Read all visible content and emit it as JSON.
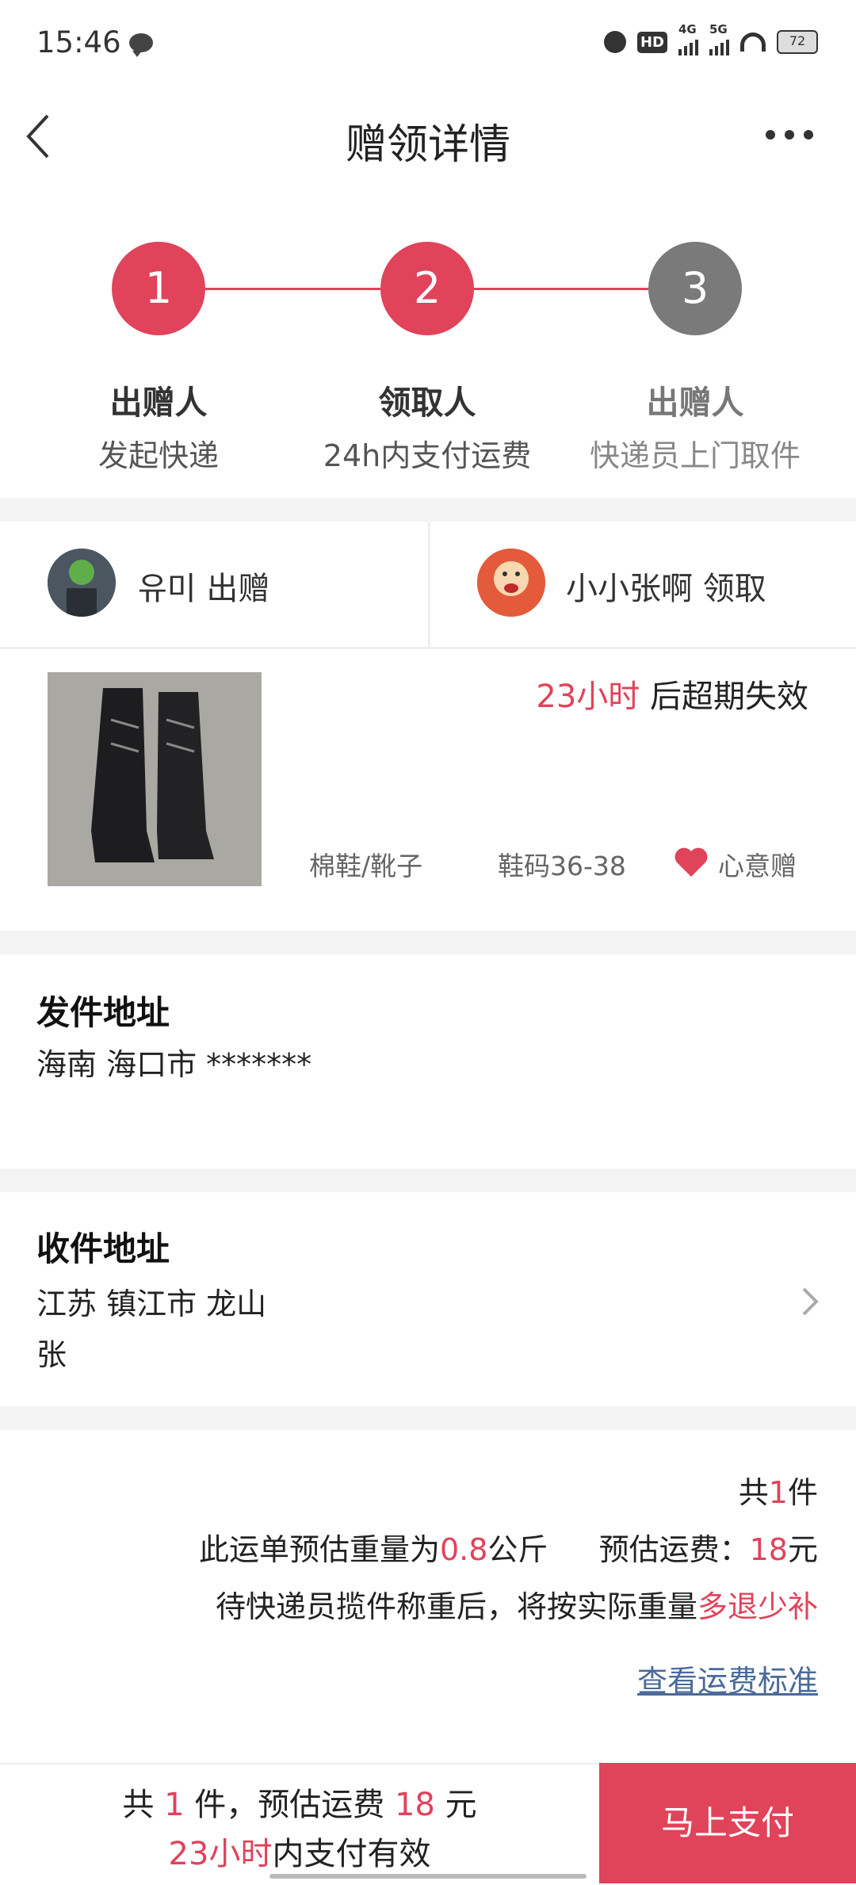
{
  "status_bar": {
    "time": "15:46",
    "battery": "72",
    "net1": "4G",
    "net2": "5G"
  },
  "header": {
    "title": "赠领详情"
  },
  "steps": [
    {
      "num": "1",
      "title": "出赠人",
      "subtitle": "发起快递",
      "color": "#e0435a"
    },
    {
      "num": "2",
      "title": "领取人",
      "subtitle": "24h内支付运费",
      "color": "#e0435a"
    },
    {
      "num": "3",
      "title": "出赠人",
      "subtitle": "快递员上门取件",
      "color": "#7a7a7a"
    }
  ],
  "parties": {
    "giver": "유미 出赠",
    "receiver": "小小张啊 领取"
  },
  "item": {
    "expire_highlight": "23小时",
    "expire_rest": "后超期失效",
    "category": "棉鞋/靴子",
    "size": "鞋码36-38",
    "tag": "心意赠"
  },
  "sender_address": {
    "title": "发件地址",
    "line1": "海南 海口市 *******"
  },
  "receiver_address": {
    "title": "收件地址",
    "line1": "江苏 镇江市 龙山",
    "line2": "张"
  },
  "summary": {
    "count_prefix": "共",
    "count": "1",
    "count_suffix": "件",
    "weight_prefix": "此运单预估重量为",
    "weight": "0.8",
    "weight_unit": "公斤",
    "fee_label": "预估运费：",
    "fee": "18",
    "fee_unit": "元",
    "note_prefix": "待快递员揽件称重后，将按实际重量",
    "note_highlight": "多退少补",
    "link": "查看运费标准"
  },
  "bottom": {
    "line1_a": "共",
    "line1_count": "1",
    "line1_b": "件，预估运费",
    "line1_fee": "18",
    "line1_c": "元",
    "line2_highlight": "23小时",
    "line2_rest": "内支付有效",
    "pay_button": "马上支付"
  },
  "colors": {
    "accent": "#e0435a",
    "link": "#4a6a9a"
  }
}
